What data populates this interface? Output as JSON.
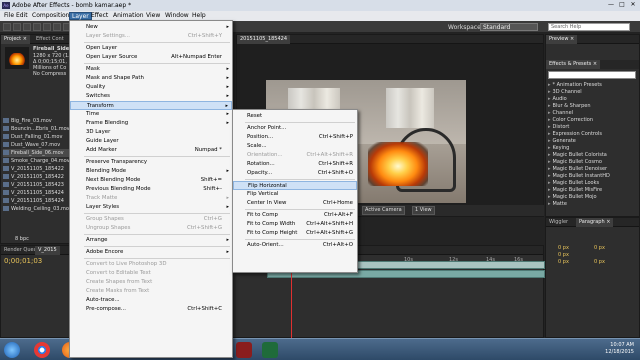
{
  "window": {
    "title": "Adobe After Effects - bomb kamar.aep *",
    "app_badge": "Ae",
    "minimize": "—",
    "maximize": "□",
    "close": "✕"
  },
  "menubar": [
    "File",
    "Edit",
    "Composition",
    "Layer",
    "Effect",
    "Animation",
    "View",
    "Window",
    "Help"
  ],
  "toolbar": {
    "workspace_label": "Workspace:",
    "workspace_value": "Standard",
    "search_placeholder": "Search Help"
  },
  "project_panel": {
    "tab_project": "Project ×",
    "tab_effect_controls": "Effect Cont",
    "selected_name": "Fireball_Side_",
    "info_line1": "1280 x 720 (1.",
    "info_line2": "Δ 0;00;15;01,",
    "info_line3": "Millions of Co",
    "info_line4": "No Compress",
    "files": [
      "Big_Fire_03.mov",
      "Bouncin...Ebris_01.mov",
      "Dust_Falling_01.mov",
      "Dust_Wave_07.mov",
      "Fireball_Side_06.mov",
      "Smoke_Charge_04.mov",
      "V_20151105_185422",
      "V_20151105_185422",
      "V_20151105_185423",
      "V_20151105_185424",
      "V_20151105_185424",
      "Welding_Ceiling_03.mov"
    ],
    "bpc": "8 bpc"
  },
  "viewer": {
    "tab_label": "20151105_185424",
    "bottom_camera": "Active Camera",
    "bottom_views": "1 View"
  },
  "right_panel": {
    "preview_tab": "Preview ×",
    "effects_tab": "Effects & Presets ×",
    "search_placeholder": "",
    "effects": [
      "* Animation Presets",
      "3D Channel",
      "Audio",
      "Blur & Sharpen",
      "Channel",
      "Color Correction",
      "Distort",
      "Expression Controls",
      "Generate",
      "Keying",
      "Magic Bullet Colorista",
      "Magic Bullet Cosmo",
      "Magic Bullet Denoiser",
      "Magic Bullet InstantHD",
      "Magic Bullet Looks",
      "Magic Bullet MisFire",
      "Magic Bullet Mojo",
      "Matte"
    ]
  },
  "paragraph_panel": {
    "wiggler_tab": "Wiggler",
    "paragraph_tab": "Paragraph ×",
    "values": [
      "0 px",
      "0 px",
      "0 px",
      "0 px",
      "0 px"
    ]
  },
  "timeline": {
    "render_queue_tab": "Render Queue",
    "comp_tab": "V_2015",
    "timecode": "0;00;01;03",
    "ruler": [
      "10s",
      "12s",
      "14s",
      "16s"
    ]
  },
  "layer_menu": {
    "items": [
      {
        "label": "New",
        "shortcut": "",
        "sub": true,
        "disabled": false
      },
      {
        "label": "Layer Settings...",
        "shortcut": "Ctrl+Shift+Y",
        "sub": false,
        "disabled": true
      },
      {
        "sep": true
      },
      {
        "label": "Open Layer",
        "shortcut": "",
        "sub": false,
        "disabled": false
      },
      {
        "label": "Open Layer Source",
        "shortcut": "Alt+Numpad Enter",
        "sub": false,
        "disabled": false
      },
      {
        "sep": true
      },
      {
        "label": "Mask",
        "shortcut": "",
        "sub": true,
        "disabled": false
      },
      {
        "label": "Mask and Shape Path",
        "shortcut": "",
        "sub": true,
        "disabled": false
      },
      {
        "label": "Quality",
        "shortcut": "",
        "sub": true,
        "disabled": false
      },
      {
        "label": "Switches",
        "shortcut": "",
        "sub": true,
        "disabled": false
      },
      {
        "label": "Transform",
        "shortcut": "",
        "sub": true,
        "disabled": false,
        "highlight": true
      },
      {
        "label": "Time",
        "shortcut": "",
        "sub": true,
        "disabled": false
      },
      {
        "label": "Frame Blending",
        "shortcut": "",
        "sub": true,
        "disabled": false
      },
      {
        "label": "3D Layer",
        "shortcut": "",
        "sub": false,
        "disabled": false
      },
      {
        "label": "Guide Layer",
        "shortcut": "",
        "sub": false,
        "disabled": false
      },
      {
        "label": "Add Marker",
        "shortcut": "Numpad *",
        "sub": false,
        "disabled": false
      },
      {
        "sep": true
      },
      {
        "label": "Preserve Transparency",
        "shortcut": "",
        "sub": false,
        "disabled": false
      },
      {
        "label": "Blending Mode",
        "shortcut": "",
        "sub": true,
        "disabled": false
      },
      {
        "label": "Next Blending Mode",
        "shortcut": "Shift+=",
        "sub": false,
        "disabled": false
      },
      {
        "label": "Previous Blending Mode",
        "shortcut": "Shift+-",
        "sub": false,
        "disabled": false
      },
      {
        "label": "Track Matte",
        "shortcut": "",
        "sub": true,
        "disabled": true
      },
      {
        "label": "Layer Styles",
        "shortcut": "",
        "sub": true,
        "disabled": false
      },
      {
        "sep": true
      },
      {
        "label": "Group Shapes",
        "shortcut": "Ctrl+G",
        "sub": false,
        "disabled": true
      },
      {
        "label": "Ungroup Shapes",
        "shortcut": "Ctrl+Shift+G",
        "sub": false,
        "disabled": true
      },
      {
        "sep": true
      },
      {
        "label": "Arrange",
        "shortcut": "",
        "sub": true,
        "disabled": false
      },
      {
        "sep": true
      },
      {
        "label": "Adobe Encore",
        "shortcut": "",
        "sub": true,
        "disabled": false
      },
      {
        "sep": true
      },
      {
        "label": "Convert to Live Photoshop 3D",
        "shortcut": "",
        "sub": false,
        "disabled": true
      },
      {
        "label": "Convert to Editable Text",
        "shortcut": "",
        "sub": false,
        "disabled": true
      },
      {
        "label": "Create Shapes from Text",
        "shortcut": "",
        "sub": false,
        "disabled": true
      },
      {
        "label": "Create Masks from Text",
        "shortcut": "",
        "sub": false,
        "disabled": true
      },
      {
        "label": "Auto-trace...",
        "shortcut": "",
        "sub": false,
        "disabled": false
      },
      {
        "label": "Pre-compose...",
        "shortcut": "Ctrl+Shift+C",
        "sub": false,
        "disabled": false
      }
    ]
  },
  "transform_menu": {
    "items": [
      {
        "label": "Reset",
        "shortcut": "",
        "disabled": false
      },
      {
        "sep": true
      },
      {
        "label": "Anchor Point...",
        "shortcut": "",
        "disabled": false
      },
      {
        "label": "Position...",
        "shortcut": "Ctrl+Shift+P",
        "disabled": false
      },
      {
        "label": "Scale...",
        "shortcut": "",
        "disabled": false
      },
      {
        "label": "Orientation...",
        "shortcut": "Ctrl+Alt+Shift+R",
        "disabled": true
      },
      {
        "label": "Rotation...",
        "shortcut": "Ctrl+Shift+R",
        "disabled": false
      },
      {
        "label": "Opacity...",
        "shortcut": "Ctrl+Shift+O",
        "disabled": false
      },
      {
        "sep": true
      },
      {
        "label": "Flip Horizontal",
        "shortcut": "",
        "disabled": false,
        "highlight": true
      },
      {
        "label": "Flip Vertical",
        "shortcut": "",
        "disabled": false
      },
      {
        "label": "Center In View",
        "shortcut": "Ctrl+Home",
        "disabled": false
      },
      {
        "sep": true
      },
      {
        "label": "Fit to Comp",
        "shortcut": "Ctrl+Alt+F",
        "disabled": false
      },
      {
        "label": "Fit to Comp Width",
        "shortcut": "Ctrl+Alt+Shift+H",
        "disabled": false
      },
      {
        "label": "Fit to Comp Height",
        "shortcut": "Ctrl+Alt+Shift+G",
        "disabled": false
      },
      {
        "sep": true
      },
      {
        "label": "Auto-Orient...",
        "shortcut": "Ctrl+Alt+O",
        "disabled": false
      }
    ]
  },
  "taskbar": {
    "time": "10:07 AM",
    "date": "12/18/2015",
    "apps": [
      "Start",
      "Chrome",
      "Firefox",
      "Explorer",
      "Media",
      "Photoshop",
      "Premiere",
      "After Effects"
    ]
  },
  "colors": {
    "menu_highlight": "#cfe1f6",
    "timeline_bar": "#79a9a4",
    "playhead": "#e03030",
    "taskbar": "#3c5a7c"
  }
}
